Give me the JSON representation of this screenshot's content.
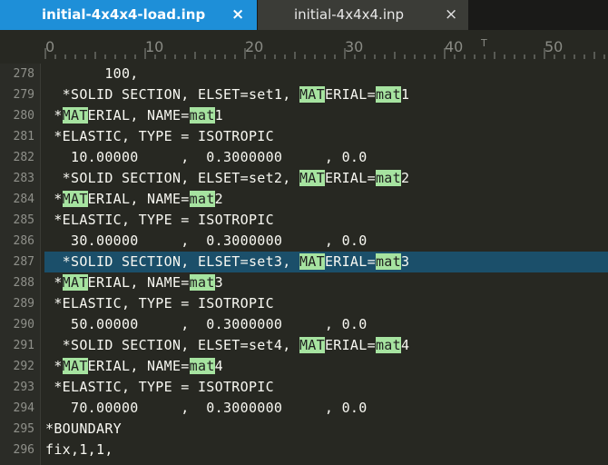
{
  "tabs": [
    {
      "label": "initial-4x4x4-load.inp",
      "close": "×"
    },
    {
      "label": "initial-4x4x4.inp",
      "close": "×"
    }
  ],
  "ruler": {
    "labels": [
      "0",
      "10",
      "20",
      "30",
      "40",
      "50"
    ],
    "caret_marker": "T"
  },
  "editor": {
    "highlight_color": "#a6e3a0",
    "current_line_color": "#1b4f6a",
    "search_term": "MAT",
    "current_line_number": "287",
    "lines": [
      {
        "n": "278",
        "parts": [
          [
            "       100,",
            0
          ]
        ]
      },
      {
        "n": "279",
        "parts": [
          [
            "  *SOLID SECTION, ELSET=set1, ",
            0
          ],
          [
            "MAT",
            1
          ],
          [
            "ERIAL=",
            0
          ],
          [
            "mat",
            1
          ],
          [
            "1",
            0
          ]
        ]
      },
      {
        "n": "280",
        "parts": [
          [
            " *",
            0
          ],
          [
            "MAT",
            1
          ],
          [
            "ERIAL, NAME=",
            0
          ],
          [
            "mat",
            1
          ],
          [
            "1",
            0
          ]
        ]
      },
      {
        "n": "281",
        "parts": [
          [
            " *ELASTIC, TYPE = ISOTROPIC",
            0
          ]
        ]
      },
      {
        "n": "282",
        "parts": [
          [
            "   10.00000     ,  0.3000000     , 0.0",
            0
          ]
        ]
      },
      {
        "n": "283",
        "parts": [
          [
            "  *SOLID SECTION, ELSET=set2, ",
            0
          ],
          [
            "MAT",
            1
          ],
          [
            "ERIAL=",
            0
          ],
          [
            "mat",
            1
          ],
          [
            "2",
            0
          ]
        ]
      },
      {
        "n": "284",
        "parts": [
          [
            " *",
            0
          ],
          [
            "MAT",
            1
          ],
          [
            "ERIAL, NAME=",
            0
          ],
          [
            "mat",
            1
          ],
          [
            "2",
            0
          ]
        ]
      },
      {
        "n": "285",
        "parts": [
          [
            " *ELASTIC, TYPE = ISOTROPIC",
            0
          ]
        ]
      },
      {
        "n": "286",
        "parts": [
          [
            "   30.00000     ,  0.3000000     , 0.0",
            0
          ]
        ]
      },
      {
        "n": "287",
        "parts": [
          [
            "  *SOLID SECTION, ELSET=set3, ",
            0
          ],
          [
            "MAT",
            1
          ],
          [
            "ERIAL=",
            0
          ],
          [
            "mat",
            1
          ],
          [
            "3",
            0
          ]
        ]
      },
      {
        "n": "288",
        "parts": [
          [
            " *",
            0
          ],
          [
            "MAT",
            1
          ],
          [
            "ERIAL, NAME=",
            0
          ],
          [
            "mat",
            1
          ],
          [
            "3",
            0
          ]
        ]
      },
      {
        "n": "289",
        "parts": [
          [
            " *ELASTIC, TYPE = ISOTROPIC",
            0
          ]
        ]
      },
      {
        "n": "290",
        "parts": [
          [
            "   50.00000     ,  0.3000000     , 0.0",
            0
          ]
        ]
      },
      {
        "n": "291",
        "parts": [
          [
            "  *SOLID SECTION, ELSET=set4, ",
            0
          ],
          [
            "MAT",
            1
          ],
          [
            "ERIAL=",
            0
          ],
          [
            "mat",
            1
          ],
          [
            "4",
            0
          ]
        ]
      },
      {
        "n": "292",
        "parts": [
          [
            " *",
            0
          ],
          [
            "MAT",
            1
          ],
          [
            "ERIAL, NAME=",
            0
          ],
          [
            "mat",
            1
          ],
          [
            "4",
            0
          ]
        ]
      },
      {
        "n": "293",
        "parts": [
          [
            " *ELASTIC, TYPE = ISOTROPIC",
            0
          ]
        ]
      },
      {
        "n": "294",
        "parts": [
          [
            "   70.00000     ,  0.3000000     , 0.0",
            0
          ]
        ]
      },
      {
        "n": "295",
        "parts": [
          [
            "*BOUNDARY",
            0
          ]
        ]
      },
      {
        "n": "296",
        "parts": [
          [
            "fix,1,1,",
            0
          ]
        ]
      }
    ]
  }
}
